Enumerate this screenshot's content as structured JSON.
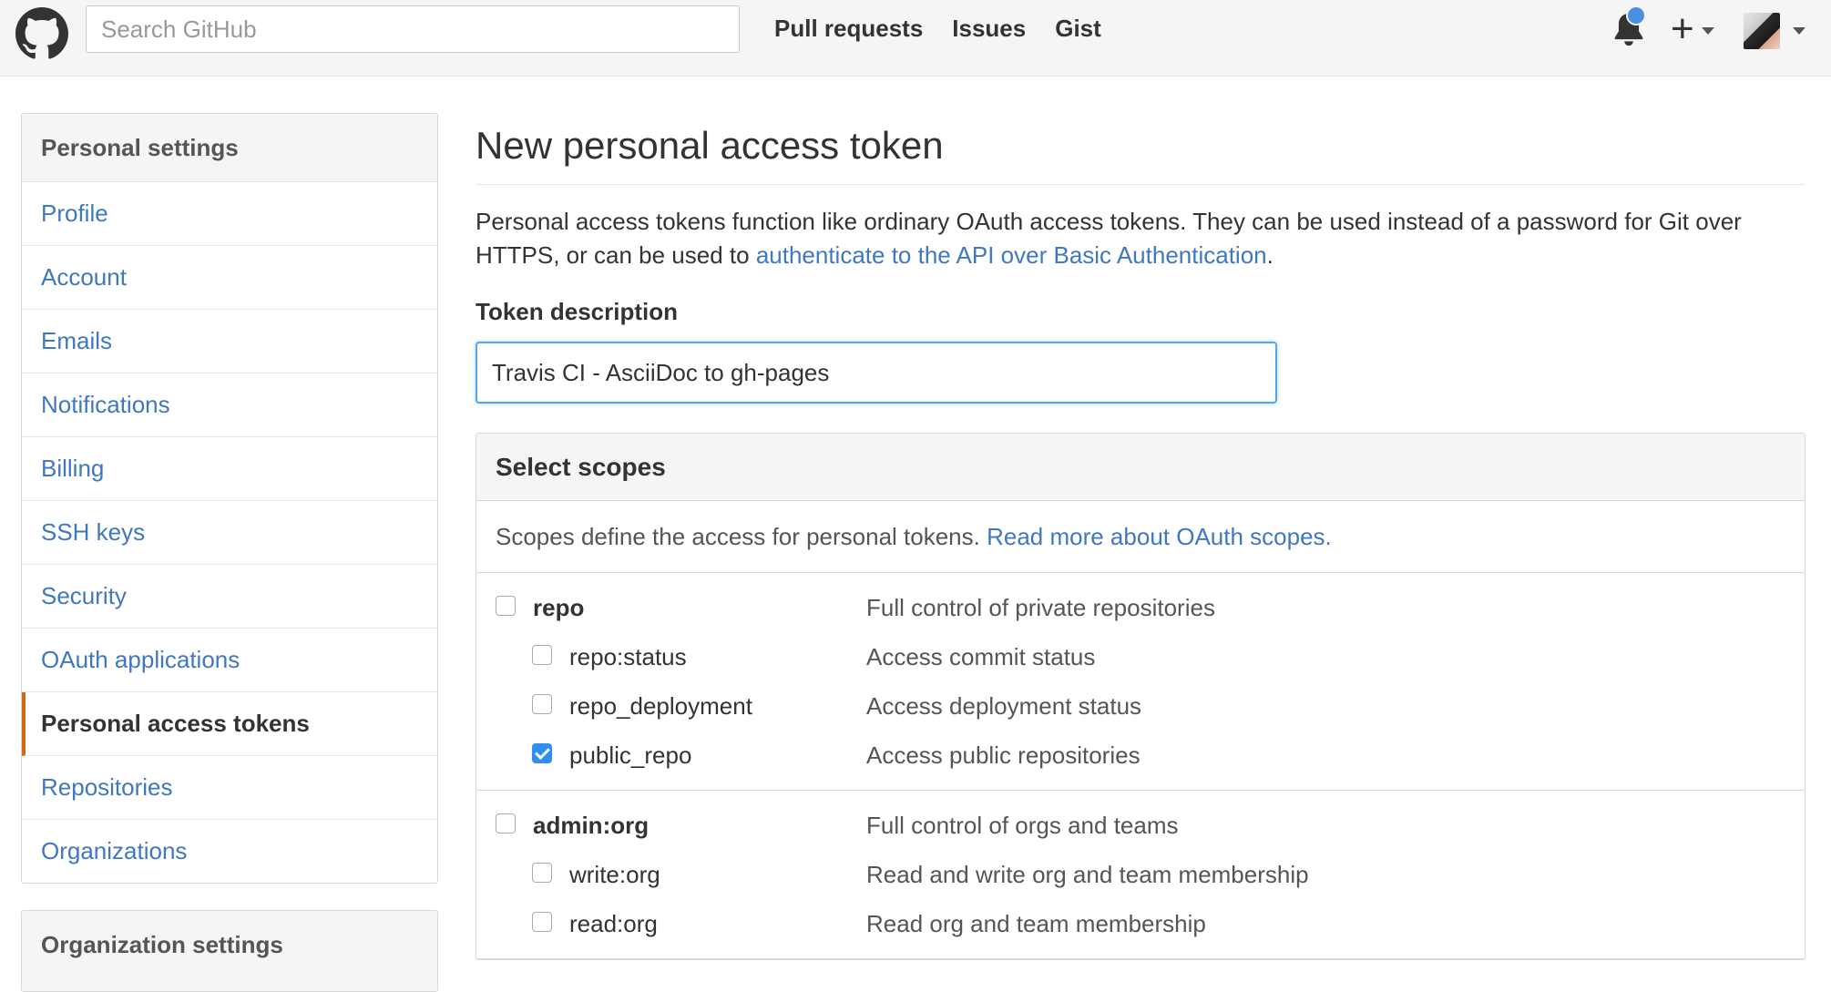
{
  "header": {
    "search_placeholder": "Search GitHub",
    "nav": [
      "Pull requests",
      "Issues",
      "Gist"
    ],
    "icons": [
      "github-logo-icon",
      "bell-icon",
      "plus-icon",
      "avatar"
    ]
  },
  "sidebar": {
    "title": "Personal settings",
    "items": [
      {
        "label": "Profile"
      },
      {
        "label": "Account"
      },
      {
        "label": "Emails"
      },
      {
        "label": "Notifications"
      },
      {
        "label": "Billing"
      },
      {
        "label": "SSH keys"
      },
      {
        "label": "Security"
      },
      {
        "label": "OAuth applications"
      },
      {
        "label": "Personal access tokens",
        "selected": true
      },
      {
        "label": "Repositories"
      },
      {
        "label": "Organizations"
      }
    ],
    "org_title": "Organization settings"
  },
  "main": {
    "title": "New personal access token",
    "description_part1": "Personal access tokens function like ordinary OAuth access tokens. They can be used instead of a password for Git over HTTPS, or can be used to ",
    "description_link": "authenticate to the API over Basic Authentication",
    "description_part2": ".",
    "token_label": "Token description",
    "token_value": "Travis CI - AsciiDoc to gh-pages",
    "scopes_title": "Select scopes",
    "scopes_desc": "Scopes define the access for personal tokens. ",
    "scopes_link": "Read more about OAuth scopes.",
    "scope_groups": [
      {
        "name": "repo",
        "desc": "Full control of private repositories",
        "checked": false,
        "children": [
          {
            "name": "repo:status",
            "desc": "Access commit status",
            "checked": false
          },
          {
            "name": "repo_deployment",
            "desc": "Access deployment status",
            "checked": false
          },
          {
            "name": "public_repo",
            "desc": "Access public repositories",
            "checked": true
          }
        ]
      },
      {
        "name": "admin:org",
        "desc": "Full control of orgs and teams",
        "checked": false,
        "children": [
          {
            "name": "write:org",
            "desc": "Read and write org and team membership",
            "checked": false
          },
          {
            "name": "read:org",
            "desc": "Read org and team membership",
            "checked": false
          }
        ]
      }
    ]
  },
  "colors": {
    "link": "#4078c0",
    "selected_accent": "#d26911",
    "checkbox_checked": "#2f8ef0",
    "notification_dot": "#4a90e2"
  }
}
